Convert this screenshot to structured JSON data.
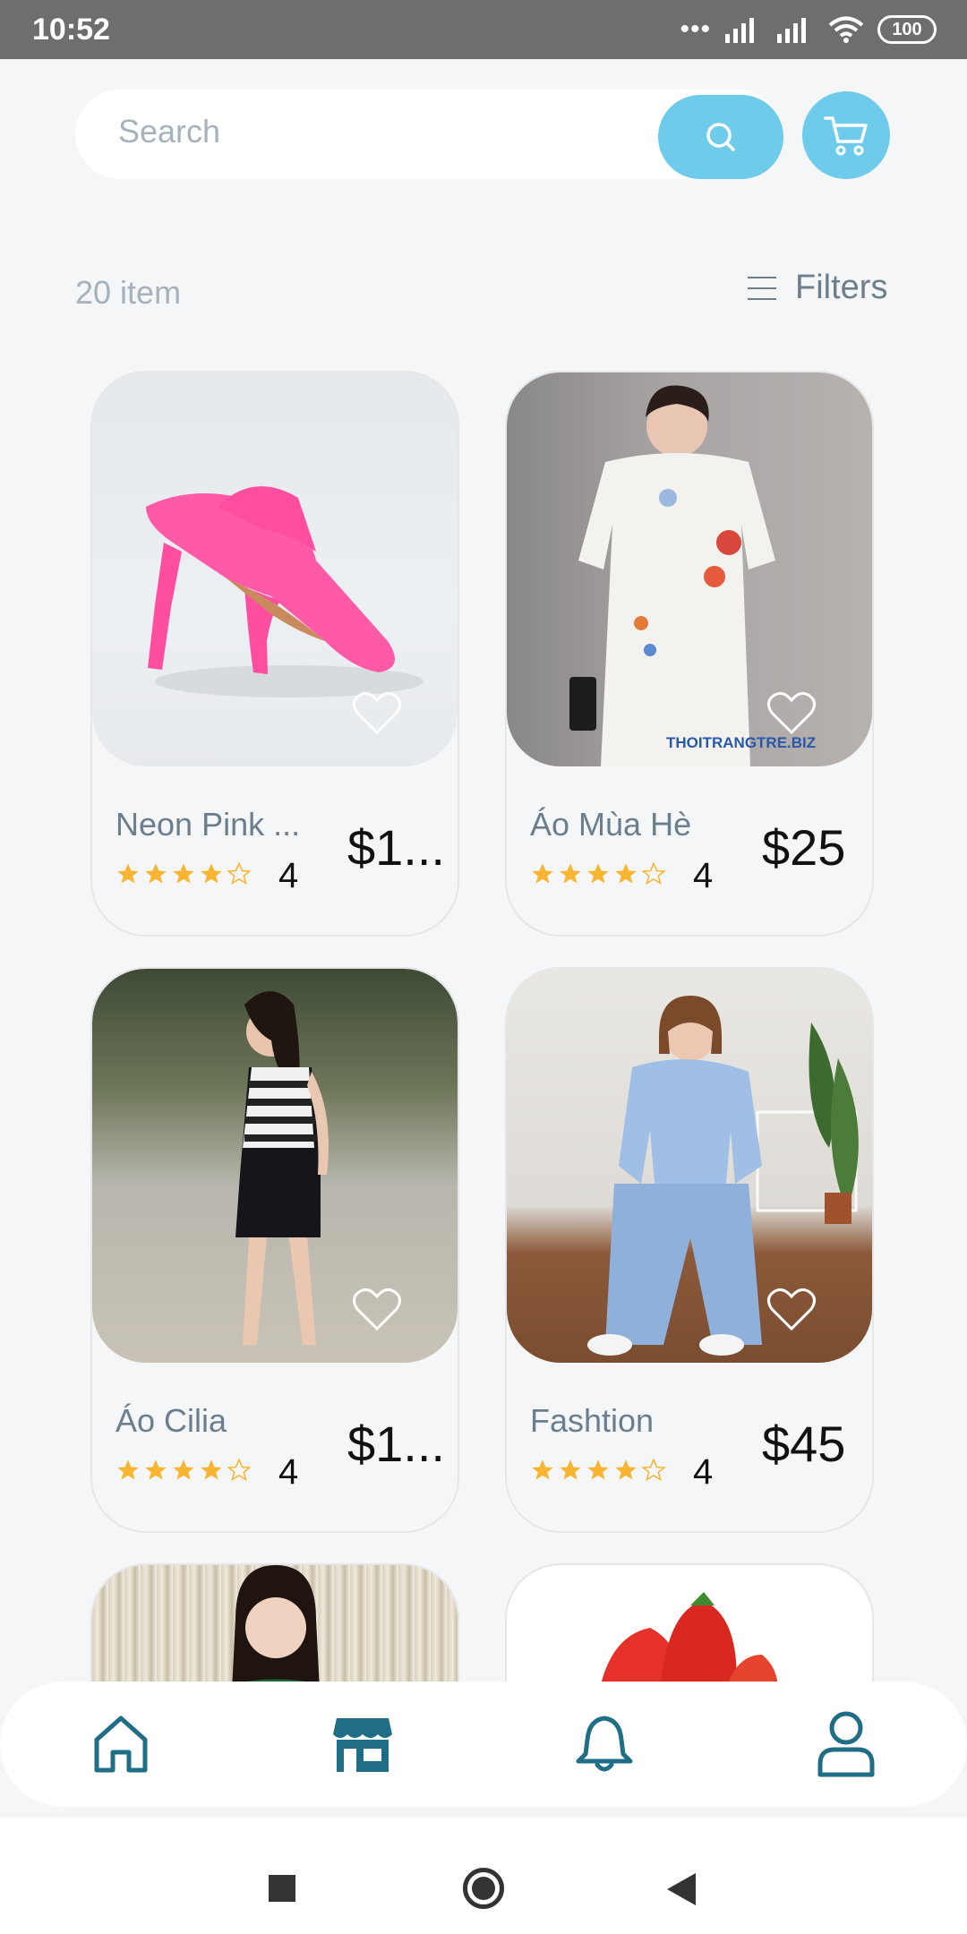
{
  "status_bar": {
    "time": "10:52",
    "battery": "100"
  },
  "search": {
    "placeholder": "Search",
    "icon": "search-icon",
    "cart_icon": "cart-icon"
  },
  "toolbar": {
    "item_count": "20 item",
    "filters_label": "Filters"
  },
  "colors": {
    "accent": "#6ecbea",
    "nav_icon": "#1f6e86",
    "star": "#f8b531"
  },
  "products": [
    {
      "name": "Neon Pink ...",
      "price": "$1...",
      "rating": "4",
      "stars": 4
    },
    {
      "name": "Áo Mùa Hè",
      "price": "$25",
      "rating": "4",
      "stars": 4,
      "watermark": "THOITRANGTRE.BIZ"
    },
    {
      "name": "Áo Cilia",
      "price": "$1...",
      "rating": "4",
      "stars": 4
    },
    {
      "name": "Fashtion",
      "price": "$45",
      "rating": "4",
      "stars": 4
    }
  ],
  "bottom_nav": [
    "home-icon",
    "store-icon",
    "bell-icon",
    "user-icon"
  ]
}
